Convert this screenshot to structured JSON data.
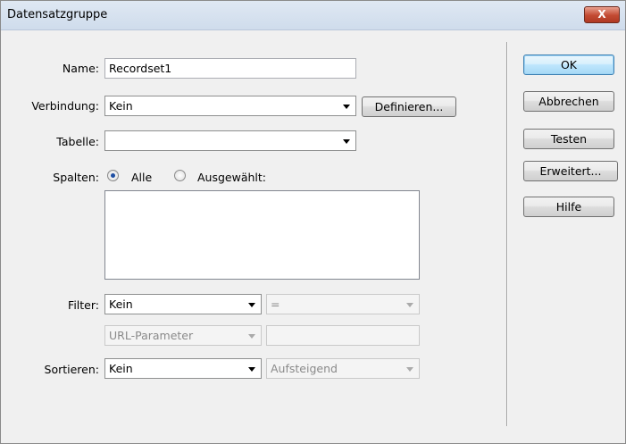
{
  "window": {
    "title": "Datensatzgruppe",
    "close_glyph": "X"
  },
  "form": {
    "name_label": "Name:",
    "name_value": "Recordset1",
    "connection_label": "Verbindung:",
    "connection_value": "Kein",
    "define_button": "Definieren...",
    "table_label": "Tabelle:",
    "table_value": "",
    "columns_label": "Spalten:",
    "columns_all": "Alle",
    "columns_selected": "Ausgewählt:",
    "filter_label": "Filter:",
    "filter_value": "Kein",
    "filter_operator": "=",
    "filter_source": "URL-Parameter",
    "filter_param_value": "",
    "sort_label": "Sortieren:",
    "sort_value": "Kein",
    "sort_order": "Aufsteigend"
  },
  "buttons": {
    "ok": "OK",
    "cancel": "Abbrechen",
    "test": "Testen",
    "advanced": "Erweitert...",
    "help": "Hilfe"
  }
}
